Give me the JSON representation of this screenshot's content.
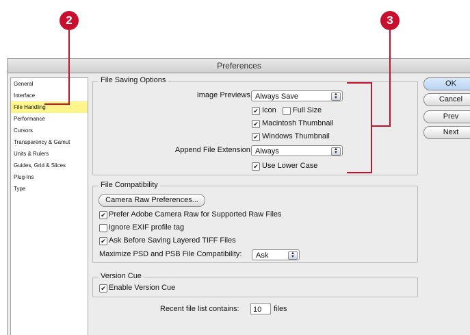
{
  "callouts": {
    "left": "2",
    "right": "3"
  },
  "window": {
    "title": "Preferences"
  },
  "sidebar": {
    "items": [
      {
        "label": "General"
      },
      {
        "label": "Interface"
      },
      {
        "label": "File Handling",
        "selected": true
      },
      {
        "label": "Performance"
      },
      {
        "label": "Cursors"
      },
      {
        "label": "Transparency & Gamut"
      },
      {
        "label": "Units & Rulers"
      },
      {
        "label": "Guides, Grid & Slices"
      },
      {
        "label": "Plug-Ins"
      },
      {
        "label": "Type"
      }
    ]
  },
  "file_saving": {
    "title": "File Saving Options",
    "image_previews_label": "Image Previews:",
    "image_previews_value": "Always Save",
    "icon_label": "Icon",
    "icon_checked": true,
    "full_size_label": "Full Size",
    "full_size_checked": false,
    "mac_thumb_label": "Macintosh Thumbnail",
    "mac_thumb_checked": true,
    "win_thumb_label": "Windows Thumbnail",
    "win_thumb_checked": true,
    "append_ext_label": "Append File Extension:",
    "append_ext_value": "Always",
    "lower_case_label": "Use Lower Case",
    "lower_case_checked": true
  },
  "file_compat": {
    "title": "File Compatibility",
    "camera_raw_button": "Camera Raw Preferences...",
    "prefer_acr_label": "Prefer Adobe Camera Raw for Supported Raw Files",
    "prefer_acr_checked": true,
    "ignore_exif_label": "Ignore EXIF profile tag",
    "ignore_exif_checked": false,
    "ask_tiff_label": "Ask Before Saving Layered TIFF Files",
    "ask_tiff_checked": true,
    "maximize_label": "Maximize PSD and PSB File Compatibility:",
    "maximize_value": "Ask"
  },
  "version_cue": {
    "title": "Version Cue",
    "enable_label": "Enable Version Cue",
    "enable_checked": true
  },
  "recent": {
    "label": "Recent file list contains:",
    "value": "10",
    "suffix": "files"
  },
  "buttons": {
    "ok": "OK",
    "cancel": "Cancel",
    "prev": "Prev",
    "next": "Next"
  },
  "colors": {
    "callout": "#c8102e",
    "selection": "#fef58d",
    "window_bg": "#ececec"
  },
  "check_glyph": "✔"
}
